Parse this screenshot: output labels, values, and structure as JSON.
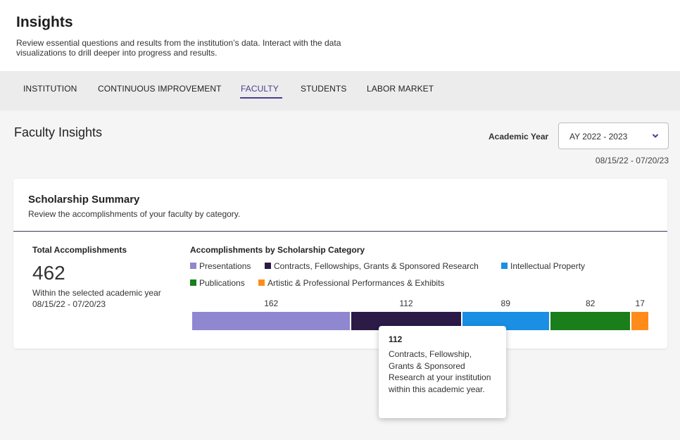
{
  "header": {
    "title": "Insights",
    "description": "Review essential questions and results from the institution’s data. Interact with the data visualizations to drill deeper into progress and results."
  },
  "tabs": [
    {
      "label": "INSTITUTION",
      "active": false
    },
    {
      "label": "CONTINUOUS IMPROVEMENT",
      "active": false
    },
    {
      "label": "FACULTY",
      "active": true
    },
    {
      "label": "STUDENTS",
      "active": false
    },
    {
      "label": "LABOR MARKET",
      "active": false
    }
  ],
  "section": {
    "title": "Faculty Insights",
    "academic_year_label": "Academic Year",
    "academic_year_value": "AY 2022 - 2023",
    "date_range": "08/15/22 - 07/20/23"
  },
  "card": {
    "title": "Scholarship Summary",
    "subtitle": "Review the accomplishments of your faculty by category.",
    "total_label": "Total Accomplishments",
    "total_value": "462",
    "total_desc": "Within the selected academic year 08/15/22 - 07/20/23",
    "chart_title": "Accomplishments by Scholarship Category"
  },
  "colors": {
    "accent": "#4e3d91",
    "presentations": "#8f87cf",
    "contracts": "#2c1a47",
    "intellectual_property": "#1a8fe3",
    "publications": "#1a7f1a",
    "artistic": "#ff8c1a"
  },
  "chart_data": {
    "type": "bar",
    "orientation": "horizontal-stacked",
    "title": "Accomplishments by Scholarship Category",
    "legend_position": "top",
    "categories": [
      "Presentations",
      "Contracts, Fellowships, Grants & Sponsored Research",
      "Intellectual Property",
      "Publications",
      "Artistic & Professional Performances & Exhibits"
    ],
    "values": [
      162,
      112,
      89,
      82,
      17
    ]
  },
  "tooltip": {
    "value": "112",
    "text": "Contracts, Fellowship, Grants & Sponsored Research at your institution within this academic year."
  }
}
